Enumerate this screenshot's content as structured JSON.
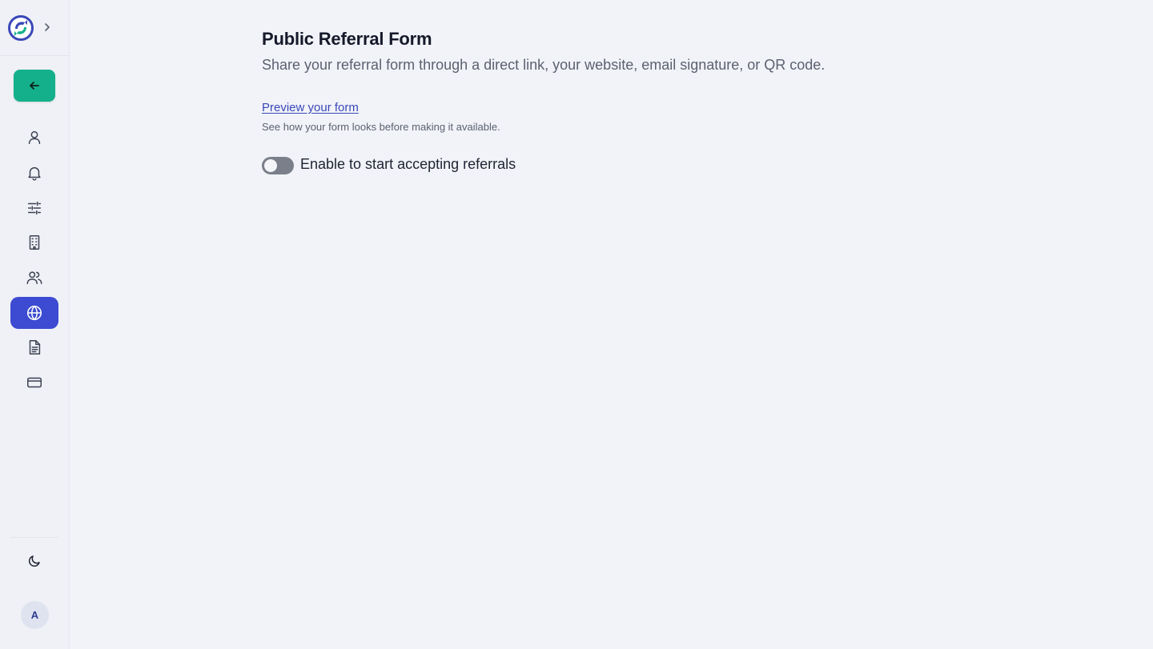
{
  "sidebar": {
    "logo_icon": "brand-logo-icon",
    "expand_icon": "chevron-right-icon",
    "back_icon": "arrow-left-icon",
    "back_color": "#14b08b",
    "items": [
      {
        "icon": "user-icon",
        "active": false
      },
      {
        "icon": "bell-icon",
        "active": false
      },
      {
        "icon": "sliders-icon",
        "active": false
      },
      {
        "icon": "building-icon",
        "active": false
      },
      {
        "icon": "users-icon",
        "active": false
      },
      {
        "icon": "globe-icon",
        "active": true
      },
      {
        "icon": "document-icon",
        "active": false
      },
      {
        "icon": "credit-card-icon",
        "active": false
      }
    ],
    "active_color": "#3c4bd1",
    "theme_icon": "moon-icon",
    "avatar_initial": "A"
  },
  "main": {
    "title": "Public Referral Form",
    "subtitle": "Share your referral form through a direct link, your website, email signature, or QR code.",
    "preview_link": "Preview your form",
    "preview_help": "See how your form looks before making it available.",
    "toggle_enabled": false,
    "toggle_label": "Enable to start accepting referrals"
  }
}
